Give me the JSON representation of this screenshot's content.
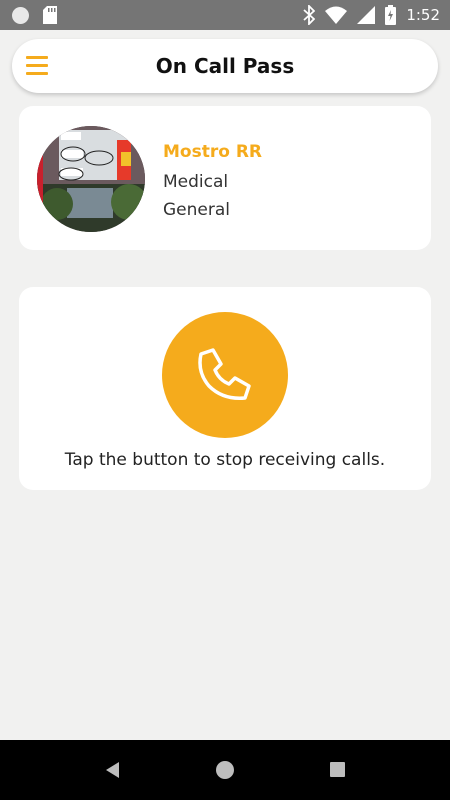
{
  "status_bar": {
    "time": "1:52",
    "icons": [
      "notification-dot-icon",
      "sd-card-icon",
      "bluetooth-icon",
      "wifi-icon",
      "cell-signal-icon",
      "battery-charging-icon"
    ]
  },
  "app_bar": {
    "title": "On Call Pass",
    "menu_icon": "hamburger-menu-icon"
  },
  "profile": {
    "name": "Mostro RR",
    "line1": "Medical",
    "line2": "General",
    "avatar": "profile-photo"
  },
  "call": {
    "button_icon": "phone-icon",
    "instruction": "Tap the button to stop receiving calls."
  },
  "nav_bar": {
    "icons": [
      "back-icon",
      "home-icon",
      "recents-icon"
    ]
  },
  "colors": {
    "accent": "#f5ab1c",
    "background": "#f1f1f0",
    "card": "#ffffff",
    "status_bar": "#757575"
  }
}
